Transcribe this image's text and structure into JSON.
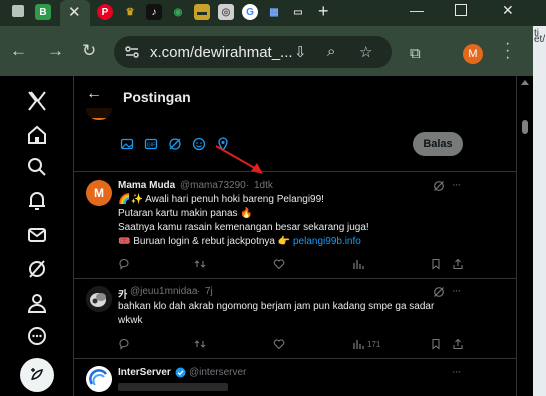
{
  "browser": {
    "tabs": [
      {
        "icon": "b-letter-icon",
        "glyph": "B",
        "color": "#2e9b4a"
      },
      {
        "icon": "pinterest-icon",
        "glyph": "P",
        "color": "#e60023"
      },
      {
        "icon": "crest-icon",
        "glyph": "♛",
        "color": "#c9a227"
      },
      {
        "icon": "tiktok-icon",
        "glyph": "♪",
        "color": "#111111"
      },
      {
        "icon": "maps-pin-icon",
        "glyph": "◉",
        "color": "#34a853"
      },
      {
        "icon": "folder-icon",
        "glyph": "▬",
        "color": "#c9a227"
      },
      {
        "icon": "settings-app-icon",
        "glyph": "◎",
        "color": "#d0d0d0"
      },
      {
        "icon": "google-icon",
        "glyph": "G",
        "color": "#ffffff"
      },
      {
        "icon": "store-icon",
        "glyph": "▦",
        "color": "#7aa7ff"
      }
    ],
    "url": "x.com/dewirahmat_...",
    "profile_initial": "M",
    "side_text_1": "ti",
    "side_text_2": "et/"
  },
  "x": {
    "header_title": "Postingan",
    "reply_button": "Balas",
    "tweets": [
      {
        "name": "Mama Muda",
        "handle": "@mama73290",
        "separator": "·",
        "time": "1dtk",
        "avatar_initial": "M",
        "lines": [
          "🌈✨ Awali hari penuh hoki bareng Pelangi99!",
          "Putaran kartu makin panas 🔥",
          "Saatnya kamu rasain kemenangan besar sekarang juga!",
          "🎟️ Buruan login & rebut jackpotnya 👉"
        ],
        "link": "pelangi99b.info"
      },
      {
        "name": "카",
        "handle": "@jeuu1mnidaa",
        "separator": "·",
        "time": "7j",
        "lines": [
          "bahkan klo dah akrab ngomong berjam jam pun kadang smpe ga sadar",
          "wkwk"
        ],
        "views": "171"
      },
      {
        "name": "InterServer",
        "handle": "@interserver",
        "lines": []
      }
    ]
  }
}
